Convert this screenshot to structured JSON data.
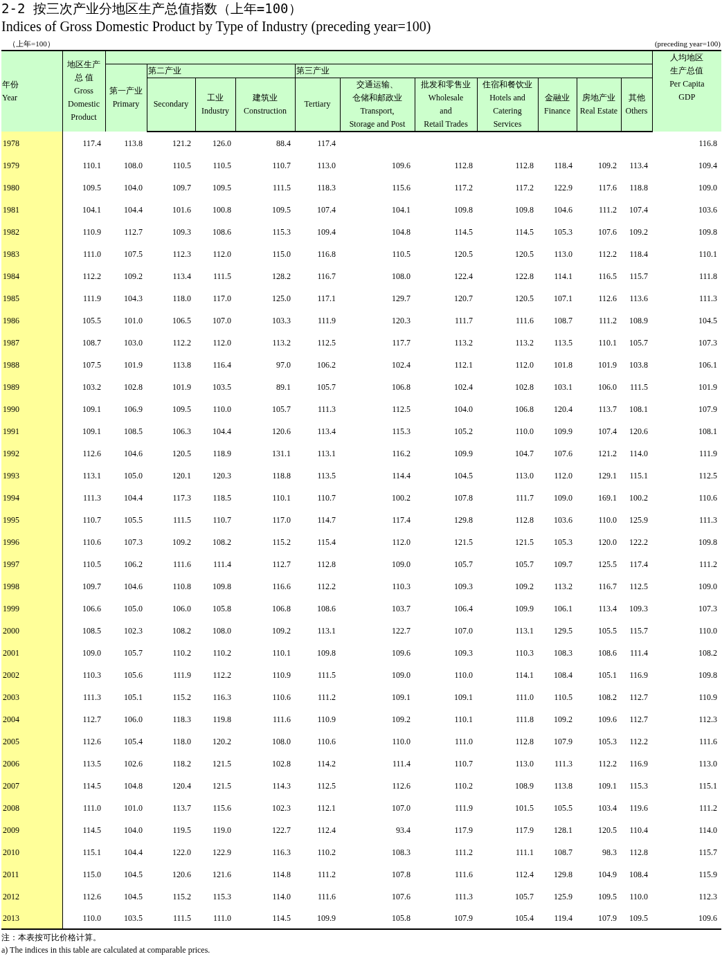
{
  "title_zh": "2-2  按三次产业分地区生产总值指数（上年=100）",
  "title_en": "Indices of Gross Domestic Product by Type of Industry (preceding year=100)",
  "unit_zh": "（上年=100）",
  "unit_en": "(preceding year=100)",
  "header": {
    "year": [
      "年份",
      "Year"
    ],
    "gdp": [
      "地区生产",
      "总  值",
      "Gross",
      "Domestic",
      "Product"
    ],
    "primary": [
      "第一产业",
      "Primary"
    ],
    "groups": [
      {
        "label": "第二产业",
        "columns": [
          [
            "Secondary"
          ],
          [
            "工业",
            "Industry"
          ],
          [
            "建筑业",
            "Construction"
          ]
        ]
      },
      {
        "label": "第三产业",
        "columns": [
          [
            "Tertiary"
          ],
          [
            "交通运输、",
            "仓储和邮政业",
            "Transport,",
            "Storage and Post"
          ],
          [
            "批发和零售业",
            "Wholesale",
            "and",
            "Retail Trades"
          ],
          [
            "住宿和餐饮业",
            "Hotels and",
            "Catering",
            "Services"
          ],
          [
            "金融业",
            "Finance"
          ],
          [
            "房地产业",
            "Real Estate"
          ],
          [
            "其他",
            "Others"
          ]
        ]
      }
    ],
    "per_capita": [
      "人均地区",
      "生产总值",
      "Per Capita",
      "GDP"
    ]
  },
  "rows": [
    {
      "year": "1978",
      "main": [
        "117.4",
        "113.8",
        "121.2",
        "126.0",
        "88.4",
        "117.4"
      ],
      "per_capita": "116.8"
    },
    {
      "year": "1979",
      "main": [
        "110.1",
        "108.0",
        "110.5",
        "110.5",
        "110.7",
        "113.0"
      ],
      "tertiary_detail": [
        "109.6",
        "112.8",
        "112.8",
        "118.4",
        "109.2",
        "113.4"
      ],
      "per_capita": "109.4"
    },
    {
      "year": "1980",
      "main": [
        "109.5",
        "104.0",
        "109.7",
        "109.5",
        "111.5",
        "118.3"
      ],
      "tertiary_detail": [
        "115.6",
        "117.2",
        "117.2",
        "122.9",
        "117.6",
        "118.8"
      ],
      "per_capita": "109.0"
    },
    {
      "year": "1981",
      "main": [
        "104.1",
        "104.4",
        "101.6",
        "100.8",
        "109.5",
        "107.4"
      ],
      "tertiary_detail": [
        "104.1",
        "109.8",
        "109.8",
        "104.6",
        "111.2",
        "107.4"
      ],
      "per_capita": "103.6"
    },
    {
      "year": "1982",
      "main": [
        "110.9",
        "112.7",
        "109.3",
        "108.6",
        "115.3",
        "109.4"
      ],
      "tertiary_detail": [
        "104.8",
        "114.5",
        "114.5",
        "105.3",
        "107.6",
        "109.2"
      ],
      "per_capita": "109.8"
    },
    {
      "year": "1983",
      "main": [
        "111.0",
        "107.5",
        "112.3",
        "112.0",
        "115.0",
        "116.8"
      ],
      "tertiary_detail": [
        "110.5",
        "120.5",
        "120.5",
        "113.0",
        "112.2",
        "118.4"
      ],
      "per_capita": "110.1"
    },
    {
      "year": "1984",
      "main": [
        "112.2",
        "109.2",
        "113.4",
        "111.5",
        "128.2",
        "116.7"
      ],
      "tertiary_detail": [
        "108.0",
        "122.4",
        "122.8",
        "114.1",
        "116.5",
        "115.7"
      ],
      "per_capita": "111.8"
    },
    {
      "year": "1985",
      "main": [
        "111.9",
        "104.3",
        "118.0",
        "117.0",
        "125.0",
        "117.1"
      ],
      "tertiary_detail": [
        "129.7",
        "120.7",
        "120.5",
        "107.1",
        "112.6",
        "113.6"
      ],
      "per_capita": "111.3"
    },
    {
      "year": "1986",
      "main": [
        "105.5",
        "101.0",
        "106.5",
        "107.0",
        "103.3",
        "111.9"
      ],
      "tertiary_detail": [
        "120.3",
        "111.7",
        "111.6",
        "108.7",
        "111.2",
        "108.9"
      ],
      "per_capita": "104.5"
    },
    {
      "year": "1987",
      "main": [
        "108.7",
        "103.0",
        "112.2",
        "112.0",
        "113.2",
        "112.5"
      ],
      "tertiary_detail": [
        "117.7",
        "113.2",
        "113.2",
        "113.5",
        "110.1",
        "105.7"
      ],
      "per_capita": "107.3"
    },
    {
      "year": "1988",
      "main": [
        "107.5",
        "101.9",
        "113.8",
        "116.4",
        "97.0",
        "106.2"
      ],
      "tertiary_detail": [
        "102.4",
        "112.1",
        "112.0",
        "101.8",
        "101.9",
        "103.8"
      ],
      "per_capita": "106.1"
    },
    {
      "year": "1989",
      "main": [
        "103.2",
        "102.8",
        "101.9",
        "103.5",
        "89.1",
        "105.7"
      ],
      "tertiary_detail": [
        "106.8",
        "102.4",
        "102.8",
        "103.1",
        "106.0",
        "111.5"
      ],
      "per_capita": "101.9"
    },
    {
      "year": "1990",
      "main": [
        "109.1",
        "106.9",
        "109.5",
        "110.0",
        "105.7",
        "111.3"
      ],
      "tertiary_detail": [
        "112.5",
        "104.0",
        "106.8",
        "120.4",
        "113.7",
        "108.1"
      ],
      "per_capita": "107.9"
    },
    {
      "year": "1991",
      "main": [
        "109.1",
        "108.5",
        "106.3",
        "104.4",
        "120.6",
        "113.4"
      ],
      "tertiary_detail": [
        "115.3",
        "105.2",
        "110.0",
        "109.9",
        "107.4",
        "120.6"
      ],
      "per_capita": "108.1"
    },
    {
      "year": "1992",
      "main": [
        "112.6",
        "104.6",
        "120.5",
        "118.9",
        "131.1",
        "113.1"
      ],
      "tertiary_detail": [
        "116.2",
        "109.9",
        "104.7",
        "107.6",
        "121.2",
        "114.0"
      ],
      "per_capita": "111.9"
    },
    {
      "year": "1993",
      "main": [
        "113.1",
        "105.0",
        "120.1",
        "120.3",
        "118.8",
        "113.5"
      ],
      "tertiary_detail": [
        "114.4",
        "104.5",
        "113.0",
        "112.0",
        "129.1",
        "115.1"
      ],
      "per_capita": "112.5"
    },
    {
      "year": "1994",
      "main": [
        "111.3",
        "104.4",
        "117.3",
        "118.5",
        "110.1",
        "110.7"
      ],
      "tertiary_detail": [
        "100.2",
        "107.8",
        "111.7",
        "109.0",
        "169.1",
        "100.2"
      ],
      "per_capita": "110.6"
    },
    {
      "year": "1995",
      "main": [
        "110.7",
        "105.5",
        "111.5",
        "110.7",
        "117.0",
        "114.7"
      ],
      "tertiary_detail": [
        "117.4",
        "129.8",
        "112.8",
        "103.6",
        "110.0",
        "125.9"
      ],
      "per_capita": "111.3"
    },
    {
      "year": "1996",
      "main": [
        "110.6",
        "107.3",
        "109.2",
        "108.2",
        "115.2",
        "115.4"
      ],
      "tertiary_detail": [
        "112.0",
        "121.5",
        "121.5",
        "105.3",
        "120.0",
        "122.2"
      ],
      "per_capita": "109.8"
    },
    {
      "year": "1997",
      "main": [
        "110.5",
        "106.2",
        "111.6",
        "111.4",
        "112.7",
        "112.8"
      ],
      "tertiary_detail": [
        "109.0",
        "105.7",
        "105.7",
        "109.7",
        "125.5",
        "117.4"
      ],
      "per_capita": "111.2"
    },
    {
      "year": "1998",
      "main": [
        "109.7",
        "104.6",
        "110.8",
        "109.8",
        "116.6",
        "112.2"
      ],
      "tertiary_detail": [
        "110.3",
        "109.3",
        "109.2",
        "113.2",
        "116.7",
        "112.5"
      ],
      "per_capita": "109.0"
    },
    {
      "year": "1999",
      "main": [
        "106.6",
        "105.0",
        "106.0",
        "105.8",
        "106.8",
        "108.6"
      ],
      "tertiary_detail": [
        "103.7",
        "106.4",
        "109.9",
        "106.1",
        "113.4",
        "109.3"
      ],
      "per_capita": "107.3"
    },
    {
      "year": "2000",
      "main": [
        "108.5",
        "102.3",
        "108.2",
        "108.0",
        "109.2",
        "113.1"
      ],
      "tertiary_detail": [
        "122.7",
        "107.0",
        "113.1",
        "129.5",
        "105.5",
        "115.7"
      ],
      "per_capita": "110.0"
    },
    {
      "year": "2001",
      "main": [
        "109.0",
        "105.7",
        "110.2",
        "110.2",
        "110.1",
        "109.8"
      ],
      "tertiary_detail": [
        "109.6",
        "109.3",
        "110.3",
        "108.3",
        "108.6",
        "111.4"
      ],
      "per_capita": "108.2"
    },
    {
      "year": "2002",
      "main": [
        "110.3",
        "105.6",
        "111.9",
        "112.2",
        "110.9",
        "111.5"
      ],
      "tertiary_detail": [
        "109.0",
        "110.0",
        "114.1",
        "108.4",
        "105.1",
        "116.9"
      ],
      "per_capita": "109.8"
    },
    {
      "year": "2003",
      "main": [
        "111.3",
        "105.1",
        "115.2",
        "116.3",
        "110.6",
        "111.2"
      ],
      "tertiary_detail": [
        "109.1",
        "109.1",
        "111.0",
        "110.5",
        "108.2",
        "112.7"
      ],
      "per_capita": "110.9"
    },
    {
      "year": "2004",
      "main": [
        "112.7",
        "106.0",
        "118.3",
        "119.8",
        "111.6",
        "110.9"
      ],
      "tertiary_detail": [
        "109.2",
        "110.1",
        "111.8",
        "109.2",
        "109.6",
        "112.7"
      ],
      "per_capita": "112.3"
    },
    {
      "year": "2005",
      "main": [
        "112.6",
        "105.4",
        "118.0",
        "120.2",
        "108.0",
        "110.6"
      ],
      "tertiary_detail": [
        "110.0",
        "111.0",
        "112.8",
        "107.9",
        "105.3",
        "112.2"
      ],
      "per_capita": "111.6"
    },
    {
      "year": "2006",
      "main": [
        "113.5",
        "102.6",
        "118.2",
        "121.5",
        "102.8",
        "114.2"
      ],
      "tertiary_detail": [
        "111.4",
        "110.7",
        "113.0",
        "111.3",
        "112.2",
        "116.9"
      ],
      "per_capita": "113.0"
    },
    {
      "year": "2007",
      "main": [
        "114.5",
        "104.8",
        "120.4",
        "121.5",
        "114.3",
        "112.5"
      ],
      "tertiary_detail": [
        "112.6",
        "110.2",
        "108.9",
        "113.8",
        "109.1",
        "115.3"
      ],
      "per_capita": "115.1"
    },
    {
      "year": "2008",
      "main": [
        "111.0",
        "101.0",
        "113.7",
        "115.6",
        "102.3",
        "112.1"
      ],
      "tertiary_detail": [
        "107.0",
        "111.9",
        "101.5",
        "105.5",
        "103.4",
        "119.6"
      ],
      "per_capita": "111.2"
    },
    {
      "year": "2009",
      "main": [
        "114.5",
        "104.0",
        "119.5",
        "119.0",
        "122.7",
        "112.4"
      ],
      "tertiary_detail": [
        "93.4",
        "117.9",
        "117.9",
        "128.1",
        "120.5",
        "110.4"
      ],
      "per_capita": "114.0"
    },
    {
      "year": "2010",
      "main": [
        "115.1",
        "104.4",
        "122.0",
        "122.9",
        "116.3",
        "110.2"
      ],
      "tertiary_detail": [
        "108.3",
        "111.2",
        "111.1",
        "108.7",
        "98.3",
        "112.8"
      ],
      "per_capita": "115.7"
    },
    {
      "year": "2011",
      "main": [
        "115.0",
        "104.5",
        "120.6",
        "121.6",
        "114.8",
        "111.2"
      ],
      "tertiary_detail": [
        "107.8",
        "111.6",
        "112.4",
        "129.8",
        "104.9",
        "108.4"
      ],
      "per_capita": "115.9"
    },
    {
      "year": "2012",
      "main": [
        "112.6",
        "104.5",
        "115.2",
        "115.3",
        "114.0",
        "111.6"
      ],
      "tertiary_detail": [
        "107.6",
        "111.3",
        "105.7",
        "125.9",
        "109.5",
        "110.0"
      ],
      "per_capita": "112.3"
    },
    {
      "year": "2013",
      "main": [
        "110.0",
        "103.5",
        "111.5",
        "111.0",
        "114.5",
        "109.9"
      ],
      "tertiary_detail": [
        "105.8",
        "107.9",
        "105.4",
        "119.4",
        "107.9",
        "109.5"
      ],
      "per_capita": "109.6"
    }
  ],
  "notes": [
    "注：本表按可比价格计算。",
    "a) The indices in this table are calculated at comparable prices."
  ]
}
